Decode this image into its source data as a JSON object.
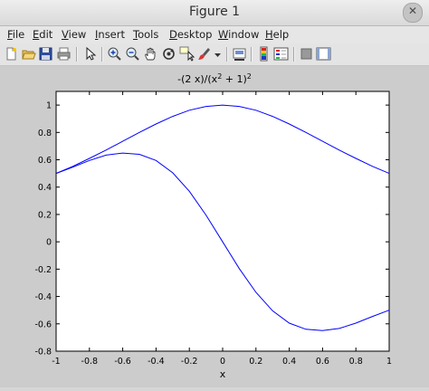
{
  "window": {
    "title": "Figure 1"
  },
  "menu": [
    {
      "key": "F",
      "rest": "ile"
    },
    {
      "key": "E",
      "rest": "dit"
    },
    {
      "key": "V",
      "rest": "iew"
    },
    {
      "key": "I",
      "rest": "nsert"
    },
    {
      "key": "T",
      "rest": "ools"
    },
    {
      "key": "D",
      "rest": "esktop"
    },
    {
      "key": "W",
      "rest": "indow"
    },
    {
      "key": "H",
      "rest": "elp"
    }
  ],
  "toolbar": {
    "icons": [
      "new-figure-icon",
      "open-file-icon",
      "save-icon",
      "print-icon",
      "arrow-pointer-icon",
      "zoom-in-icon",
      "zoom-out-icon",
      "pan-hand-icon",
      "rotate-3d-icon",
      "data-cursor-icon",
      "brush-icon",
      "dropdown-arrow-icon",
      "link-plot-icon",
      "colorbar-icon",
      "legend-icon",
      "hide-plot-tools-icon",
      "show-plot-tools-icon"
    ]
  },
  "plot": {
    "title_pre": "-(2 x)/(x",
    "title_sup1": "2",
    "title_mid": " + 1)",
    "title_sup2": "2",
    "xlabel": "x"
  },
  "chart_data": {
    "type": "line",
    "title": "-(2 x)/(x^2 + 1)^2",
    "xlabel": "x",
    "ylabel": "",
    "xlim": [
      -1,
      1
    ],
    "ylim": [
      -0.8,
      1.1
    ],
    "xticks": [
      "-1",
      "-0.8",
      "-0.6",
      "-0.4",
      "-0.2",
      "0",
      "0.2",
      "0.4",
      "0.6",
      "0.8",
      "1"
    ],
    "yticks": [
      "-0.8",
      "-0.6",
      "-0.4",
      "-0.2",
      "0",
      "0.2",
      "0.4",
      "0.6",
      "0.8",
      "1"
    ],
    "line_color": "#0000ff",
    "series": [
      {
        "x": [
          -1,
          -0.9,
          -0.8,
          -0.7,
          -0.6,
          -0.5,
          -0.4,
          -0.3,
          -0.2,
          -0.1,
          0,
          0.1,
          0.2,
          0.3,
          0.4,
          0.5,
          0.6,
          0.7,
          0.8,
          0.9,
          1
        ],
        "y": [
          0.5,
          0.552,
          0.61,
          0.671,
          0.735,
          0.8,
          0.862,
          0.917,
          0.962,
          0.99,
          1,
          0.99,
          0.962,
          0.917,
          0.862,
          0.8,
          0.735,
          0.671,
          0.61,
          0.552,
          0.5
        ]
      },
      {
        "x": [
          -1,
          -0.9,
          -0.8,
          -0.7,
          -0.6,
          -0.5,
          -0.4,
          -0.3,
          -0.2,
          -0.1,
          0,
          0.1,
          0.2,
          0.3,
          0.4,
          0.5,
          0.6,
          0.7,
          0.8,
          0.9,
          1
        ],
        "y": [
          0.5,
          0.546,
          0.595,
          0.634,
          0.649,
          0.64,
          0.595,
          0.505,
          0.37,
          0.196,
          0,
          -0.196,
          -0.37,
          -0.505,
          -0.595,
          -0.64,
          -0.649,
          -0.634,
          -0.595,
          -0.546,
          -0.5
        ]
      }
    ]
  }
}
